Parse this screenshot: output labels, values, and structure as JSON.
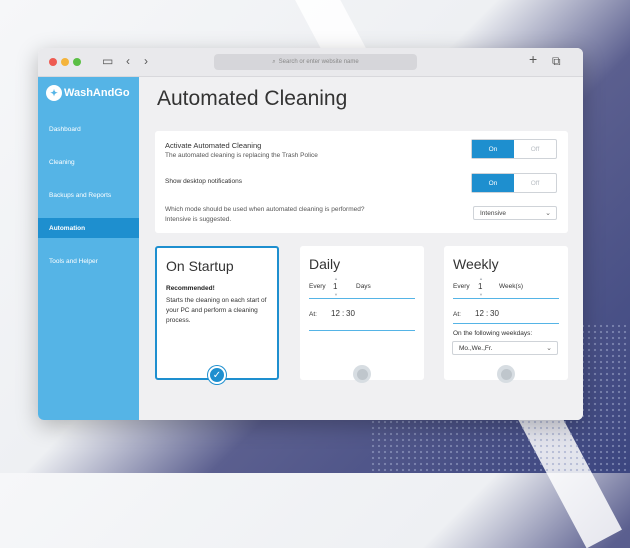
{
  "browser": {
    "address_placeholder": "Search or enter website name"
  },
  "app": {
    "brand": "WashAndGo"
  },
  "sidebar": {
    "items": [
      {
        "label": "Dashboard"
      },
      {
        "label": "Cleaning"
      },
      {
        "label": "Backups and Reports"
      },
      {
        "label": "Automation"
      },
      {
        "label": "Tools and Helper"
      }
    ]
  },
  "main": {
    "title": "Automated Cleaning",
    "settings": {
      "activate_label": "Activate Automated Cleaning",
      "activate_sub": "The automated cleaning is replacing the Trash Police",
      "notif_label": "Show desktop notifications",
      "mode_question": "Which mode should be used when automated cleaning is performed?",
      "mode_hint": "Intensive is suggested.",
      "toggle_on": "On",
      "toggle_off": "Off",
      "mode_value": "Intensive"
    },
    "cards": {
      "startup": {
        "title": "On Startup",
        "bold": "Recommended!",
        "desc": "Starts the cleaning on each start of your PC and perform a cleaning process."
      },
      "daily": {
        "title": "Daily",
        "every": "Every",
        "count": "1",
        "unit": "Days",
        "at": "At:",
        "hour": "12",
        "minute": "30",
        "sep": ":"
      },
      "weekly": {
        "title": "Weekly",
        "every": "Every",
        "count": "1",
        "unit": "Week(s)",
        "at": "At:",
        "hour": "12",
        "minute": "30",
        "sep": ":",
        "weekdays_label": "On the following weekdays:",
        "weekdays_value": "Mo.,We.,Fr."
      }
    }
  },
  "colors": {
    "accent": "#1e8fcf",
    "sidebar": "#55b4e6"
  }
}
